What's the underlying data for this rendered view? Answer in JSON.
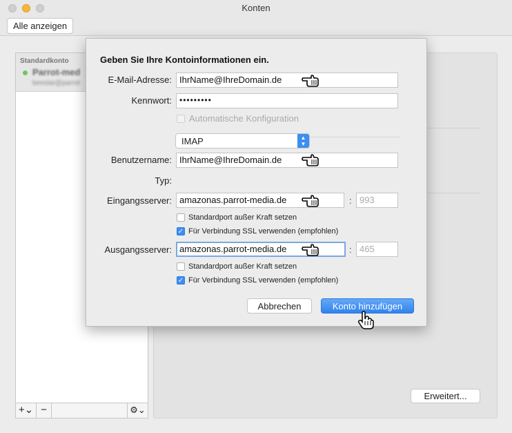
{
  "window": {
    "title": "Konten",
    "show_all_label": "Alle anzeigen"
  },
  "sidebar": {
    "group_label": "Standardkonto",
    "account_name": "Parrot-med",
    "account_email": "beeslar@parrot",
    "add_label": "+⌄",
    "remove_label": "−",
    "gear_label": "⚙⌄"
  },
  "detail": {
    "advanced_label": "Erweitert..."
  },
  "sheet": {
    "heading": "Geben Sie Ihre Kontoinformationen ein.",
    "email_label": "E-Mail-Adresse:",
    "email_value": "IhrName@IhreDomain.de",
    "password_label": "Kennwort:",
    "password_value": "•••••••••",
    "auto_config_label": "Automatische Konfiguration",
    "username_label": "Benutzername:",
    "username_value": "IhrName@IhreDomain.de",
    "type_label": "Typ:",
    "type_value": "IMAP",
    "incoming_label": "Eingangsserver:",
    "incoming_value": "amazonas.parrot-media.de",
    "incoming_port": "993",
    "incoming_override_label": "Standardport außer Kraft setzen",
    "incoming_ssl_label": "Für Verbindung SSL verwenden (empfohlen)",
    "outgoing_label": "Ausgangsserver:",
    "outgoing_value": "amazonas.parrot-media.de",
    "outgoing_port": "465",
    "outgoing_override_label": "Standardport außer Kraft setzen",
    "outgoing_ssl_label": "Für Verbindung SSL verwenden (empfohlen)",
    "colon": ":",
    "cancel_label": "Abbrechen",
    "add_label": "Konto hinzufügen"
  },
  "icons": {
    "pointing_hand": "pointing-hand-icon",
    "hand_cursor": "hand-cursor-icon",
    "checkmark": "✓",
    "popup_up": "▲",
    "popup_down": "▼"
  },
  "colors": {
    "accent": "#3d8ef0",
    "minimize": "#f5b73a",
    "status_online": "#6fc95b"
  }
}
